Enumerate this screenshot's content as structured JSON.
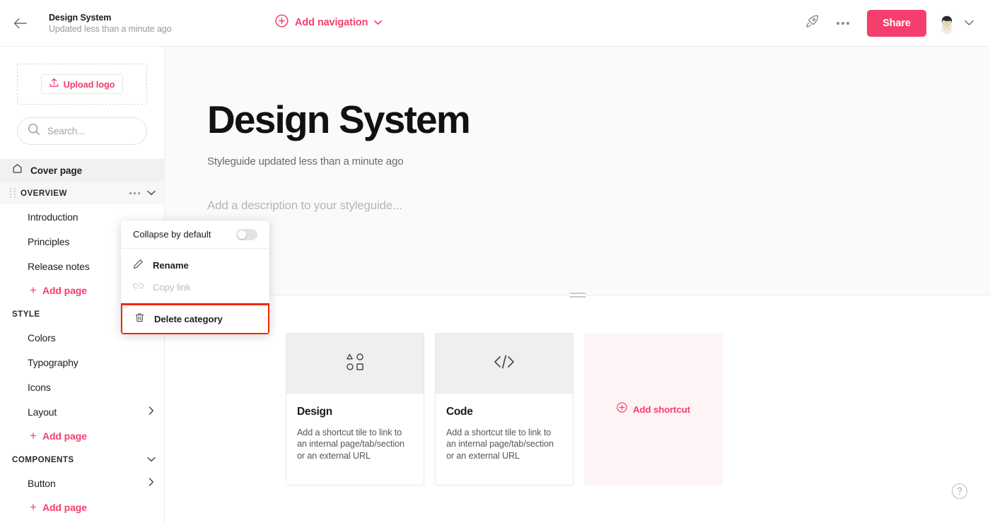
{
  "topbar": {
    "back_icon": "arrow-left-icon",
    "doc_title": "Design System",
    "doc_subtitle": "Updated less than a minute ago",
    "add_navigation_label": "Add navigation",
    "add_navigation_icon": "plus-circle-icon",
    "add_navigation_chevron": "chevron-down-icon",
    "rocket_icon": "rocket-icon",
    "more_icon": "ellipsis-icon",
    "share_label": "Share",
    "avatar_icon": "user-avatar",
    "account_chevron": "chevron-down-icon",
    "accent_color": "#f63e6e"
  },
  "sidebar": {
    "upload_logo_label": "Upload logo",
    "upload_logo_icon": "upload-icon",
    "search_placeholder": "Search...",
    "search_value": "",
    "search_icon": "search-icon",
    "cover_page": {
      "label": "Cover page",
      "icon": "home-icon"
    },
    "sections": [
      {
        "title": "OVERVIEW",
        "active": true,
        "has_drag_handle": true,
        "menu_icon": "ellipsis-icon",
        "chevron": "chevron-down-icon",
        "pages": [
          {
            "label": "Introduction",
            "chevron": ""
          },
          {
            "label": "Principles",
            "chevron": ""
          },
          {
            "label": "Release notes",
            "chevron": ""
          }
        ],
        "add_page_label": "Add page"
      },
      {
        "title": "STYLE",
        "active": false,
        "has_drag_handle": false,
        "menu_icon": "",
        "chevron": "",
        "pages": [
          {
            "label": "Colors",
            "chevron": ""
          },
          {
            "label": "Typography",
            "chevron": ""
          },
          {
            "label": "Icons",
            "chevron": ""
          },
          {
            "label": "Layout",
            "chevron": "chevron-right-icon"
          }
        ],
        "add_page_label": "Add page"
      },
      {
        "title": "COMPONENTS",
        "active": false,
        "has_drag_handle": false,
        "menu_icon": "",
        "chevron": "chevron-down-icon",
        "pages": [
          {
            "label": "Button",
            "chevron": "chevron-right-icon"
          }
        ],
        "add_page_label": "Add page"
      }
    ]
  },
  "context_menu": {
    "collapse_label": "Collapse by default",
    "collapse_toggle_state": "off",
    "rename_label": "Rename",
    "rename_icon": "pencil-icon",
    "copy_link_label": "Copy link",
    "copy_link_icon": "link-icon",
    "copy_link_disabled": true,
    "delete_label": "Delete category",
    "delete_icon": "trash-icon",
    "delete_highlight_color": "#f42a00"
  },
  "main": {
    "hero_title": "Design System",
    "hero_subtitle": "Styleguide updated less than a minute ago",
    "hero_description_placeholder": "Add a description to your styleguide...",
    "resize_handle_icon": "drag-handle-icon",
    "tiles": [
      {
        "title": "Design",
        "icon": "shapes-icon",
        "description": "Add a shortcut tile to link to an internal page/tab/section or an external URL"
      },
      {
        "title": "Code",
        "icon": "code-icon",
        "description": "Add a shortcut tile to link to an internal page/tab/section or an external URL"
      }
    ],
    "add_shortcut_label": "Add shortcut",
    "add_shortcut_icon": "plus-circle-icon",
    "help_icon": "question-mark-icon"
  }
}
